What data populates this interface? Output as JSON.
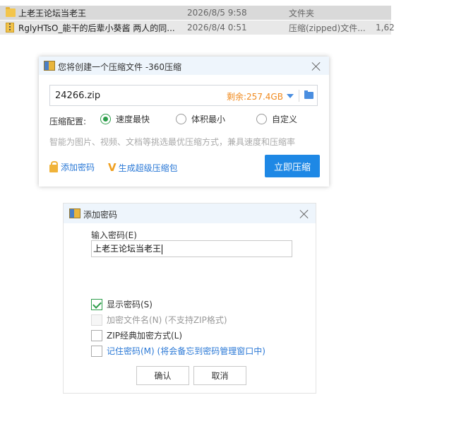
{
  "files": [
    {
      "name": "上老王论坛当老王",
      "date": "2026/8/5 9:58",
      "type": "文件夹",
      "size": "",
      "icon": "folder-icon"
    },
    {
      "name": "RglyHTsO_能干的后辈小葵酱 两人的同...",
      "date": "2026/8/4 0:51",
      "type": "压缩(zipped)文件...",
      "size": "1,62",
      "icon": "zip-file-icon"
    }
  ],
  "compress_dialog": {
    "title": "您将创建一个压缩文件 -360压缩",
    "filename": "24266.zip",
    "free_space": "剩余:257.4GB",
    "config_label": "压缩配置:",
    "options": [
      "速度最快",
      "体积最小",
      "自定义"
    ],
    "selected_option": "速度最快",
    "hint": "智能为图片、视频、文档等挑选最优压缩方式，兼具速度和压缩率",
    "add_password_link": "添加密码",
    "sfx_link": "生成超级压缩包",
    "compress_button": "立即压缩",
    "accent_color": "#1e88e5"
  },
  "password_dialog": {
    "title": "添加密码",
    "input_label": "输入密码(E)",
    "password_value": "上老王论坛当老王",
    "checkboxes": [
      {
        "label": "显示密码(S)",
        "checked": true,
        "enabled": true
      },
      {
        "label": "加密文件名(N) (不支持ZIP格式)",
        "checked": false,
        "enabled": false
      },
      {
        "label": "ZIP经典加密方式(L)",
        "checked": false,
        "enabled": true
      },
      {
        "label": "记住密码(M) (将会备忘到密码管理窗口中)",
        "checked": false,
        "enabled": true
      }
    ],
    "ok_button": "确认",
    "cancel_button": "取消"
  }
}
